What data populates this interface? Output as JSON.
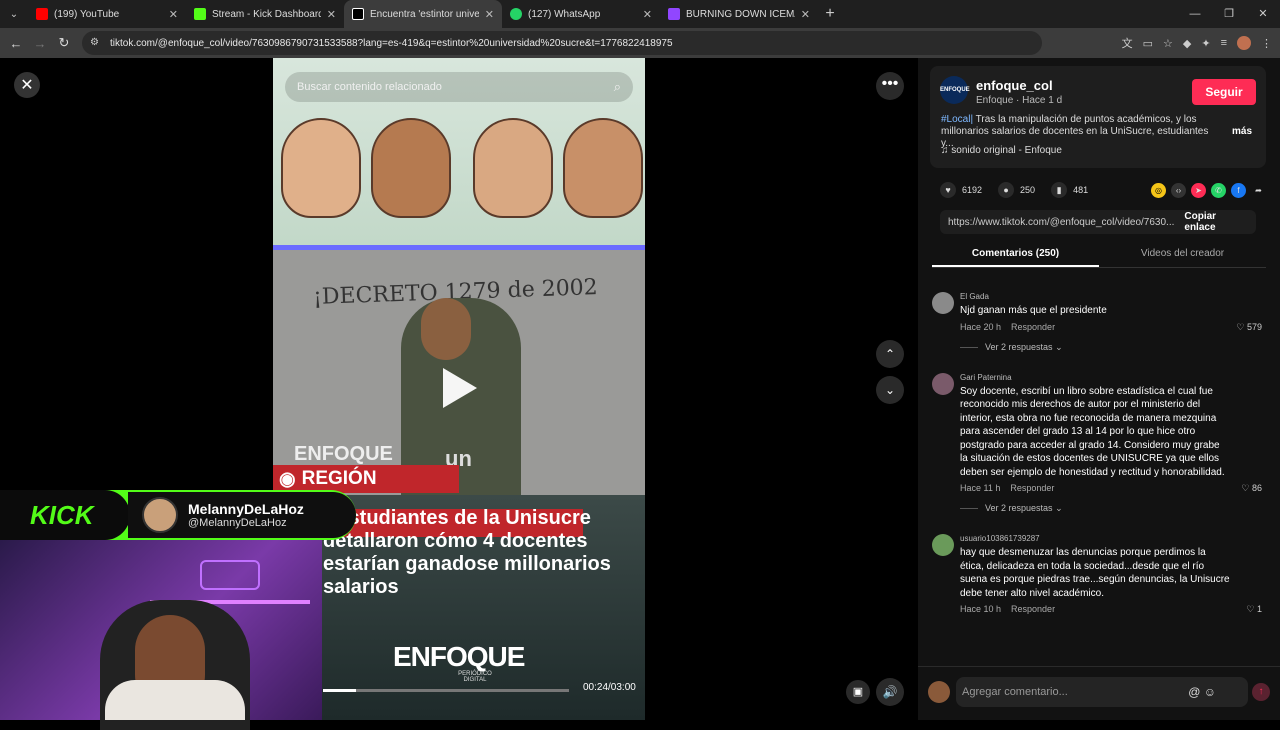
{
  "browser": {
    "tabs": [
      {
        "label": "(199) YouTube",
        "color": "#ff0000"
      },
      {
        "label": "Stream - Kick Dashboard",
        "color": "#53fc18"
      },
      {
        "label": "Encuentra 'estintor universidad",
        "color": "#ffffff"
      },
      {
        "label": "(127) WhatsApp",
        "color": "#25d366"
      },
      {
        "label": "BURNING DOWN ICEMAN FINA",
        "color": "#9146ff"
      }
    ],
    "url": "tiktok.com/@enfoque_col/video/7630986790731533588?lang=es-419&q=estintor%20universidad%20sucre&t=1776822418975"
  },
  "video": {
    "search_placeholder": "Buscar contenido relacionado",
    "board_text": "¡DECRETO 1279 de 2002",
    "brand_small": "ENFOQUE",
    "region_label": "REGIÓN",
    "un_text": "un",
    "headline": "! Estudiantes de la Unisucre detallaron cómo 4 docentes estarían ganadose millonarios salarios",
    "logo_text": "ENFOQUE",
    "logo_sub": "PERIÓDICO DIGITAL",
    "progress": 0.133,
    "time": "00:24/03:00"
  },
  "kick": {
    "logo": "KICK",
    "name": "MelannyDeLaHoz",
    "handle": "@MelannyDeLaHoz"
  },
  "author": {
    "avatar_text": "ENFOQUE",
    "username": "enfoque_col",
    "meta": "Enfoque · Hace 1 d",
    "follow_label": "Seguir",
    "tag": "#Local|",
    "description": " Tras la manipulación de puntos académicos, y los millonarios salarios de docentes en la UniSucre, estudiantes y...",
    "more_label": "más",
    "sound": "sonido original - Enfoque"
  },
  "stats": {
    "likes": "6192",
    "comments": "250",
    "saves": "481"
  },
  "share": {
    "link": "https://www.tiktok.com/@enfoque_col/video/7630...",
    "copy_label": "Copiar enlace"
  },
  "panel_tabs": {
    "comments": "Comentarios (250)",
    "videos": "Videos del creador"
  },
  "comments": [
    {
      "user": "El Gada",
      "text": "Njd ganan más que el presidente",
      "time": "Hace 20 h",
      "reply": "Responder",
      "likes": "579",
      "replies": "Ver 2 respuestas",
      "avatar_color": "#8a8a8a"
    },
    {
      "user": "Gari Paternina",
      "text": "Soy docente, escribí un libro sobre estadística el cual fue reconocido mis derechos de autor por el ministerio del interior, esta obra no fue reconocida de manera mezquina para ascender del grado 13 al 14 por lo que hice otro postgrado para acceder al grado 14. Considero muy grabe la situación de estos docentes de UNISUCRE ya que ellos deben ser ejemplo de honestidad y rectitud y honorabilidad.",
      "time": "Hace 11 h",
      "reply": "Responder",
      "likes": "86",
      "replies": "Ver 2 respuestas",
      "avatar_color": "#7a5a6a"
    },
    {
      "user": "usuario103861739287",
      "text": "hay que desmenuzar las denuncias porque perdimos la ética, delicadeza en toda la sociedad...desde que el río suena es porque piedras trae...según denuncias, la Unisucre debe tener alto nivel académico.",
      "time": "Hace 10 h",
      "reply": "Responder",
      "likes": "1",
      "replies": "",
      "avatar_color": "#6a9a5a"
    }
  ],
  "comment_input": {
    "placeholder": "Agregar comentario..."
  }
}
